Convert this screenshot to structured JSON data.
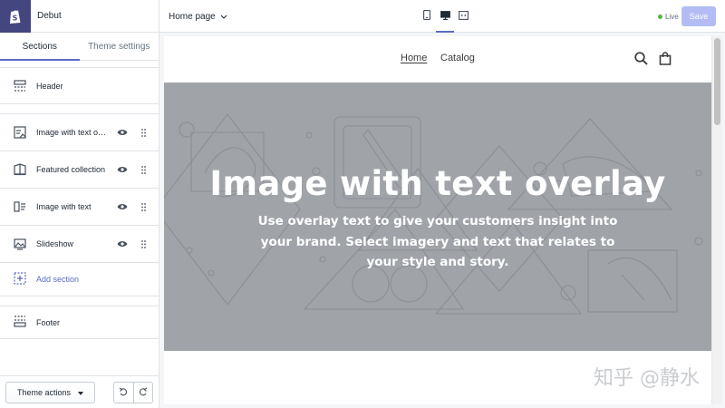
{
  "app": {
    "store_name": "Debut"
  },
  "sidebar": {
    "tabs": [
      {
        "label": "Sections",
        "active": true
      },
      {
        "label": "Theme settings",
        "active": false
      }
    ],
    "header_section": {
      "label": "Header"
    },
    "sections": [
      {
        "label": "Image with text overlay",
        "icon": "image-text-overlay-icon"
      },
      {
        "label": "Featured collection",
        "icon": "collection-icon"
      },
      {
        "label": "Image with text",
        "icon": "image-with-text-icon"
      },
      {
        "label": "Slideshow",
        "icon": "slideshow-icon"
      }
    ],
    "add_section_label": "Add section",
    "footer_section": {
      "label": "Footer"
    },
    "theme_actions_label": "Theme actions"
  },
  "topbar": {
    "page_label": "Home page",
    "devices": [
      "mobile-icon",
      "desktop-icon",
      "fullscreen-icon"
    ],
    "active_device": "desktop-icon",
    "live_label": "Live",
    "save_label": "Save"
  },
  "preview": {
    "nav": {
      "home": "Home",
      "catalog": "Catalog"
    },
    "hero": {
      "title": "Image with text overlay",
      "subtitle_lines": [
        "Use overlay text to give your customers insight into",
        "your brand. Select imagery and text that relates to",
        "your style and story."
      ]
    }
  },
  "watermark": "知乎 @静水",
  "colors": {
    "accent": "#5c6ac4",
    "brand": "#43467f",
    "save_disabled": "#b3bcf5",
    "live": "#50b83c",
    "hero_bg": "#a0a4a8"
  }
}
